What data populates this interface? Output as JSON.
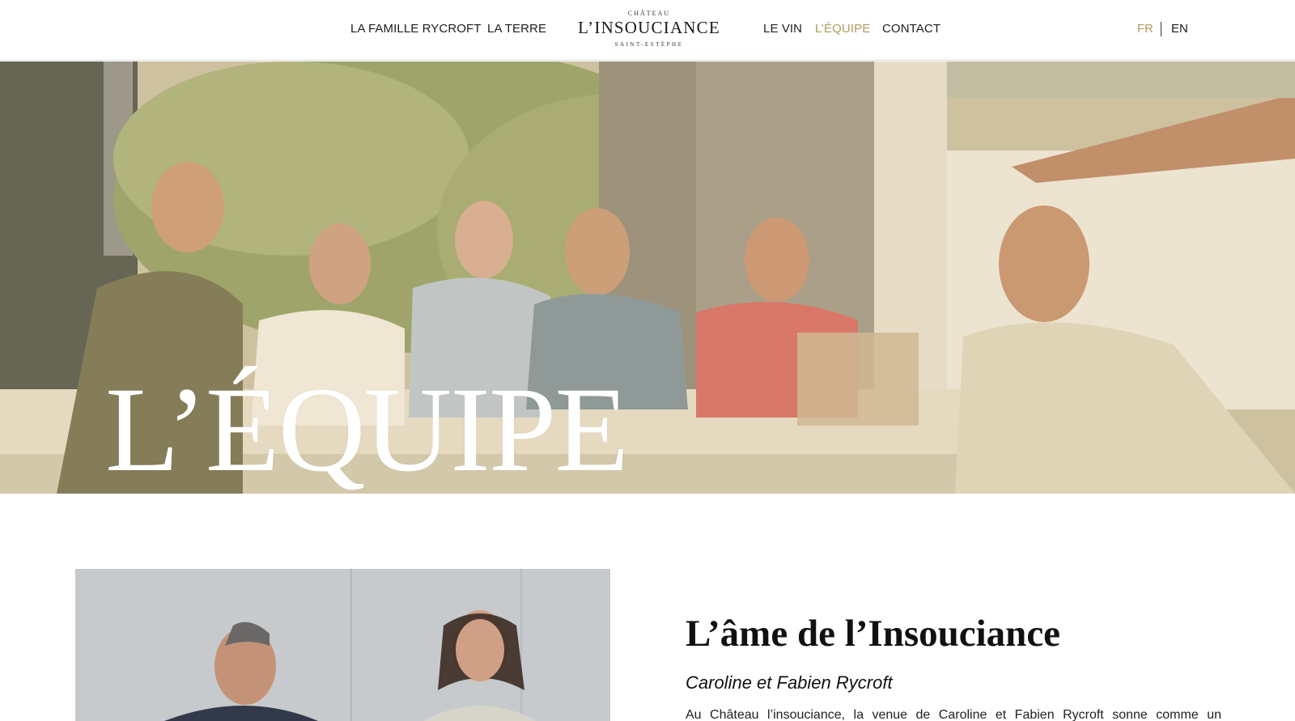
{
  "header": {
    "nav_left": [
      {
        "label": "LA FAMILLE RYCROFT"
      },
      {
        "label": "LA TERRE"
      }
    ],
    "logo": {
      "top": "CHÂTEAU",
      "main": "L’INSOUCIANCE",
      "bottom": "SAINT-ESTÈPHE"
    },
    "nav_right": [
      {
        "label": "LE VIN"
      },
      {
        "label": "L’ÉQUIPE"
      },
      {
        "label": "CONTACT"
      }
    ],
    "languages": [
      {
        "label": "FR"
      },
      {
        "label": "EN"
      }
    ],
    "active_nav": "L’ÉQUIPE",
    "active_language": "FR"
  },
  "hero": {
    "title": "L’ÉQUIPE"
  },
  "section": {
    "title": "L’âme de l’Insouciance",
    "subtitle": "Caroline et Fabien Rycroft",
    "body": "Au Château l’insouciance, la venue de Caroline et Fabien Rycroft sonne comme un"
  },
  "colors": {
    "accent": "#b49a5c",
    "text": "#1a1a1a",
    "hero_title": "#ffffff"
  }
}
